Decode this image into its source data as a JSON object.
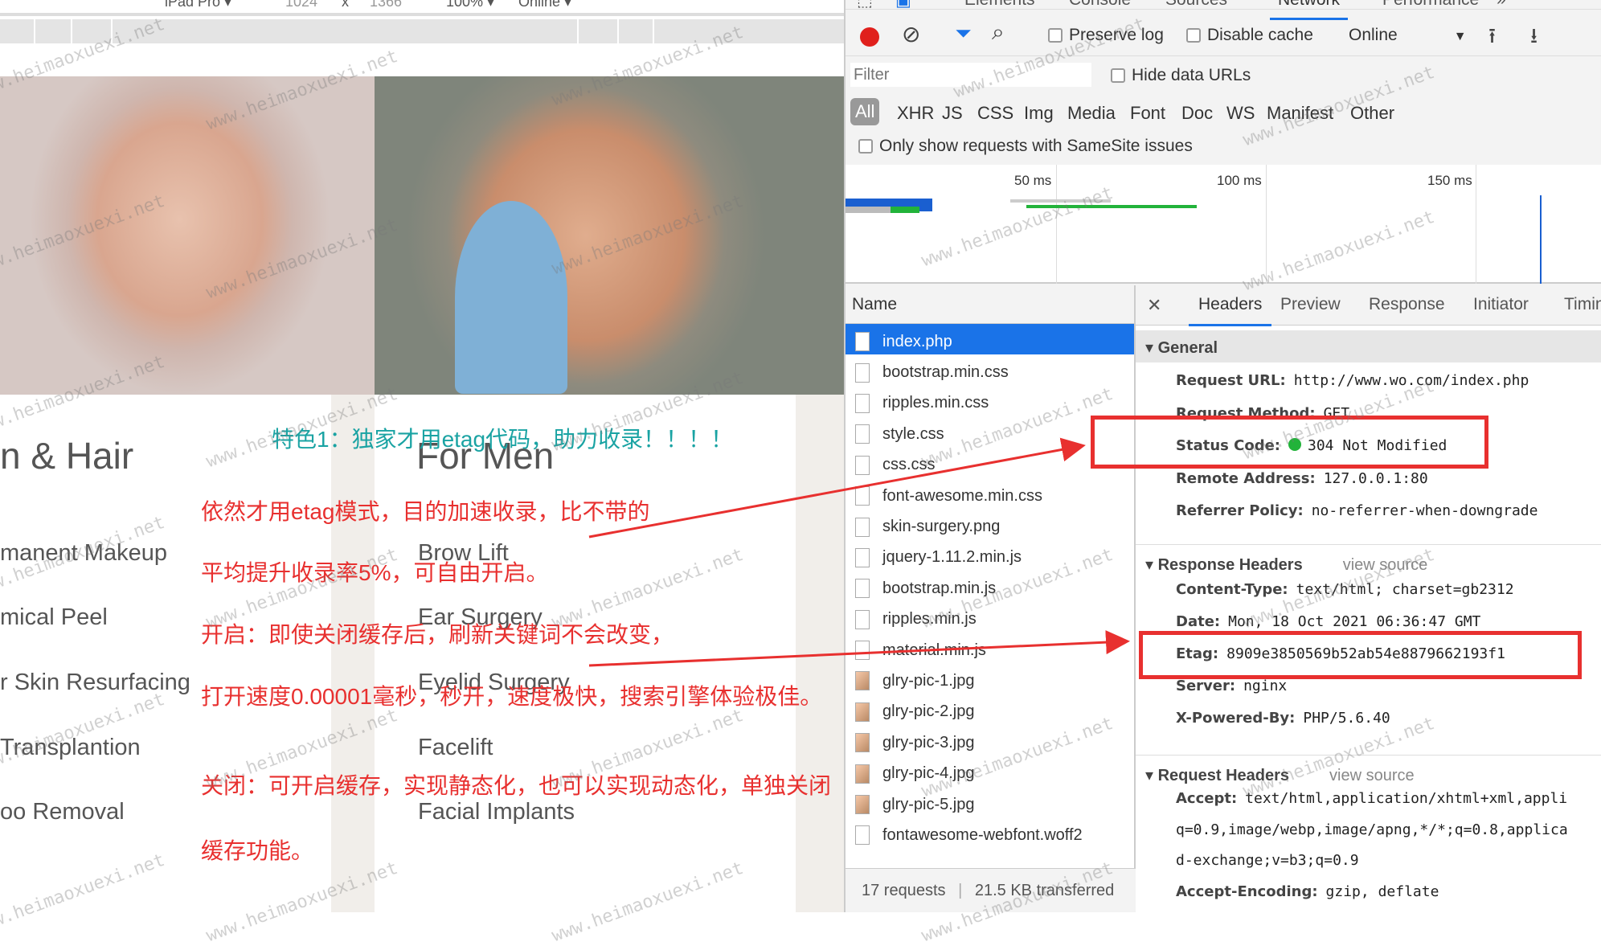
{
  "device_toolbar": {
    "device": "iPad Pro ▾",
    "width": "1024",
    "x": "x",
    "height": "1366",
    "zoom": "100% ▾",
    "throttle": "Online ▾"
  },
  "page": {
    "heading_left": "n & Hair",
    "heading_right": "For Men",
    "services_left": [
      "manent Makeup",
      "mical Peel",
      "r Skin Resurfacing",
      "Transplantion",
      "oo Removal"
    ],
    "services_right": [
      "Brow Lift",
      "Ear Surgery",
      "Eyelid Surgery",
      "Facelift",
      "Facial Implants"
    ]
  },
  "annotations": {
    "title": "特色1：独家才用etag代码，助力收录！！！！",
    "lines": [
      "依然才用etag模式，目的加速收录，比不带的",
      "平均提升收录率5%，可自由开启。",
      "开启：即使关闭缓存后，刷新关键词不会改变，",
      "打开速度0.00001毫秒，秒开，速度极快，搜索引擎体验极佳。",
      "关闭：可开启缓存，实现静态化，也可以实现动态化，单独关闭",
      "缓存功能。"
    ],
    "color": "#e8302f",
    "title_color": "#1aa3a3"
  },
  "watermark": "www.heimaoxuexi.net",
  "devtools": {
    "tabs": [
      "Elements",
      "Console",
      "Sources",
      "Network",
      "Performance",
      "»"
    ],
    "active_tab": "Network",
    "toolbar": {
      "preserve_log": "Preserve log",
      "disable_cache": "Disable cache",
      "throttle": "Online"
    },
    "filter_placeholder": "Filter",
    "hide_data_urls": "Hide data URLs",
    "types": [
      "All",
      "XHR",
      "JS",
      "CSS",
      "Img",
      "Media",
      "Font",
      "Doc",
      "WS",
      "Manifest",
      "Other"
    ],
    "samesite": "Only show requests with SameSite issues",
    "timeline_ticks": [
      "50 ms",
      "100 ms",
      "150 ms"
    ],
    "name_header": "Name",
    "files": [
      "index.php",
      "bootstrap.min.css",
      "ripples.min.css",
      "style.css",
      "css.css",
      "font-awesome.min.css",
      "skin-surgery.png",
      "jquery-1.11.2.min.js",
      "bootstrap.min.js",
      "ripples.min.js",
      "material.min.js",
      "glry-pic-1.jpg",
      "glry-pic-2.jpg",
      "glry-pic-3.jpg",
      "glry-pic-4.jpg",
      "glry-pic-5.jpg",
      "fontawesome-webfont.woff2"
    ],
    "footer": {
      "requests": "17 requests",
      "transferred": "21.5 KB transferred"
    },
    "detail_tabs": [
      "Headers",
      "Preview",
      "Response",
      "Initiator",
      "Timin"
    ],
    "general": {
      "title": "General",
      "rows": [
        [
          "Request URL:",
          "http://www.wo.com/index.php"
        ],
        [
          "Request Method:",
          "GET"
        ],
        [
          "Status Code:",
          "304 Not Modified"
        ],
        [
          "Remote Address:",
          "127.0.0.1:80"
        ],
        [
          "Referrer Policy:",
          "no-referrer-when-downgrade"
        ]
      ]
    },
    "response_headers": {
      "title": "Response Headers",
      "view_source": "view source",
      "rows": [
        [
          "Content-Type:",
          "text/html; charset=gb2312"
        ],
        [
          "Date:",
          "Mon, 18 Oct 2021 06:36:47 GMT"
        ],
        [
          "Etag:",
          "8909e3850569b52ab54e8879662193f1"
        ],
        [
          "Server:",
          "nginx"
        ],
        [
          "X-Powered-By:",
          "PHP/5.6.40"
        ]
      ]
    },
    "request_headers": {
      "title": "Request Headers",
      "view_source": "view source",
      "rows": [
        [
          "Accept:",
          "text/html,application/xhtml+xml,appli"
        ],
        [
          "",
          "q=0.9,image/webp,image/apng,*/*;q=0.8,applica"
        ],
        [
          "",
          "d-exchange;v=b3;q=0.9"
        ],
        [
          "Accept-Encoding:",
          "gzip, deflate"
        ]
      ]
    },
    "status_color": "#22b33a",
    "accent": "#1a73e8"
  }
}
